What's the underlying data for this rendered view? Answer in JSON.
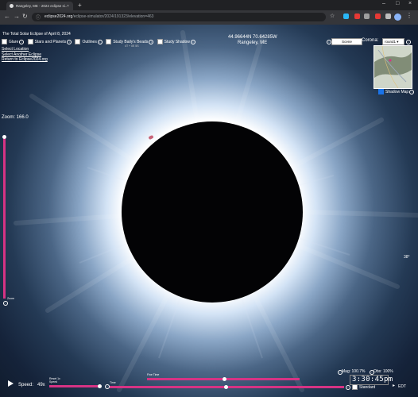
{
  "browser": {
    "tab_title": "Rangeley, ME - 2024 eclipse si...",
    "url_host": "eclipse2024.org",
    "url_rest": "/eclipse-simulator/2024/191323/elevation=463",
    "minimize": "–",
    "maximize": "□",
    "close": "×"
  },
  "overlay": {
    "title": "The Total Solar Eclipse of April 8, 2024",
    "coords": "44.96644N 70.64285W",
    "place": "Rangeley, ME",
    "options": [
      {
        "label": "Glare",
        "checked": false
      },
      {
        "label": "Stars and Planets",
        "checked": false
      },
      {
        "label": "Outlines",
        "checked": false
      },
      {
        "label": "Study Baily's Beads",
        "checked": false
      },
      {
        "label": "Study Shadow",
        "checked": false
      }
    ],
    "beads_sub": "4T + 0E 5S",
    "links": [
      "Select Location",
      "Select Another Eclipse",
      "Return to Eclipse2024.org"
    ],
    "scene_select": "Scene",
    "corona_label": "Corona:",
    "corona_select": "round1",
    "shadow_map_label": "Shadow Map",
    "zoom_label": "Zoom: 166.0",
    "zoom_slider_label": "Zoom",
    "angle_label": "38°",
    "speed_label": "Speed:",
    "speed_value": "49x",
    "reset_label": "Reset 1x",
    "speed_slider_label": "Speed",
    "time_slider_label": "Time",
    "fine_time_label": "Fine Time",
    "magnitude": "Mag: 100.7%",
    "obscuration": "Obs: 100%",
    "clock": "3:30:45pm",
    "standard_label": "Standard",
    "timezone": "EDT"
  },
  "colors": {
    "slider": "#d63384",
    "sky": "#0b1119",
    "moon": "#030305"
  }
}
